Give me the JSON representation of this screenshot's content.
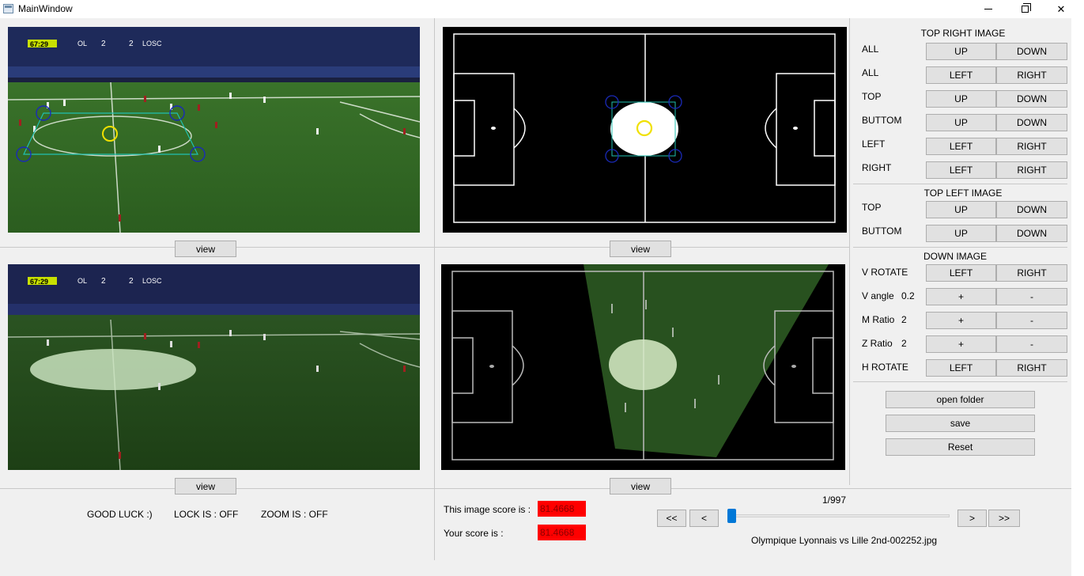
{
  "window": {
    "title": "MainWindow",
    "minimize": "–",
    "close": "✕"
  },
  "panels": {
    "view_label": "view",
    "top_left_score": {
      "left": "67:29",
      "team1": "OL",
      "s1": "2",
      "s2": "2",
      "team2": "LOSC"
    },
    "bottom_left_score": {
      "left": "67:29",
      "team1": "OL",
      "s1": "2",
      "s2": "2",
      "team2": "LOSC"
    }
  },
  "controls": {
    "top_right": {
      "header": "TOP RIGHT IMAGE",
      "rows": [
        {
          "label": "ALL",
          "b1": "UP",
          "b2": "DOWN"
        },
        {
          "label": "ALL",
          "b1": "LEFT",
          "b2": "RIGHT"
        },
        {
          "label": "TOP",
          "b1": "UP",
          "b2": "DOWN"
        },
        {
          "label": "BUTTOM",
          "b1": "UP",
          "b2": "DOWN"
        },
        {
          "label": "LEFT",
          "b1": "LEFT",
          "b2": "RIGHT"
        },
        {
          "label": "RIGHT",
          "b1": "LEFT",
          "b2": "RIGHT"
        }
      ]
    },
    "top_left": {
      "header": "TOP LEFT IMAGE",
      "rows": [
        {
          "label": "TOP",
          "b1": "UP",
          "b2": "DOWN"
        },
        {
          "label": "BUTTOM",
          "b1": "UP",
          "b2": "DOWN"
        }
      ]
    },
    "down": {
      "header": "DOWN IMAGE",
      "rows": [
        {
          "label": "V ROTATE",
          "value": "",
          "b1": "LEFT",
          "b2": "RIGHT"
        },
        {
          "label": "V angle",
          "value": "0.2",
          "b1": "+",
          "b2": "-"
        },
        {
          "label": "M Ratio",
          "value": "2",
          "b1": "+",
          "b2": "-"
        },
        {
          "label": "Z Ratio",
          "value": "2",
          "b1": "+",
          "b2": "-"
        },
        {
          "label": "H ROTATE",
          "value": "",
          "b1": "LEFT",
          "b2": "RIGHT"
        }
      ]
    },
    "actions": {
      "open_folder": "open folder",
      "save": "save",
      "reset": "Reset"
    }
  },
  "status": {
    "good_luck": "GOOD LUCK :)",
    "lock": "LOCK IS : OFF",
    "zoom": "ZOOM IS : OFF"
  },
  "scores": {
    "image_label": "This image score is :",
    "image_value": "81.4668",
    "your_label": "Your score is :",
    "your_value": "81.4668"
  },
  "navigation": {
    "counter": "1/997",
    "first": "<<",
    "prev": "<",
    "next": ">",
    "last": ">>",
    "current_index": 1,
    "total": 997,
    "filename": "Olympique Lyonnais vs Lille 2nd-002252.jpg"
  },
  "colors": {
    "score_bg": "#ff0000",
    "slider": "#0078d7",
    "pitch": "#2f6b22"
  }
}
